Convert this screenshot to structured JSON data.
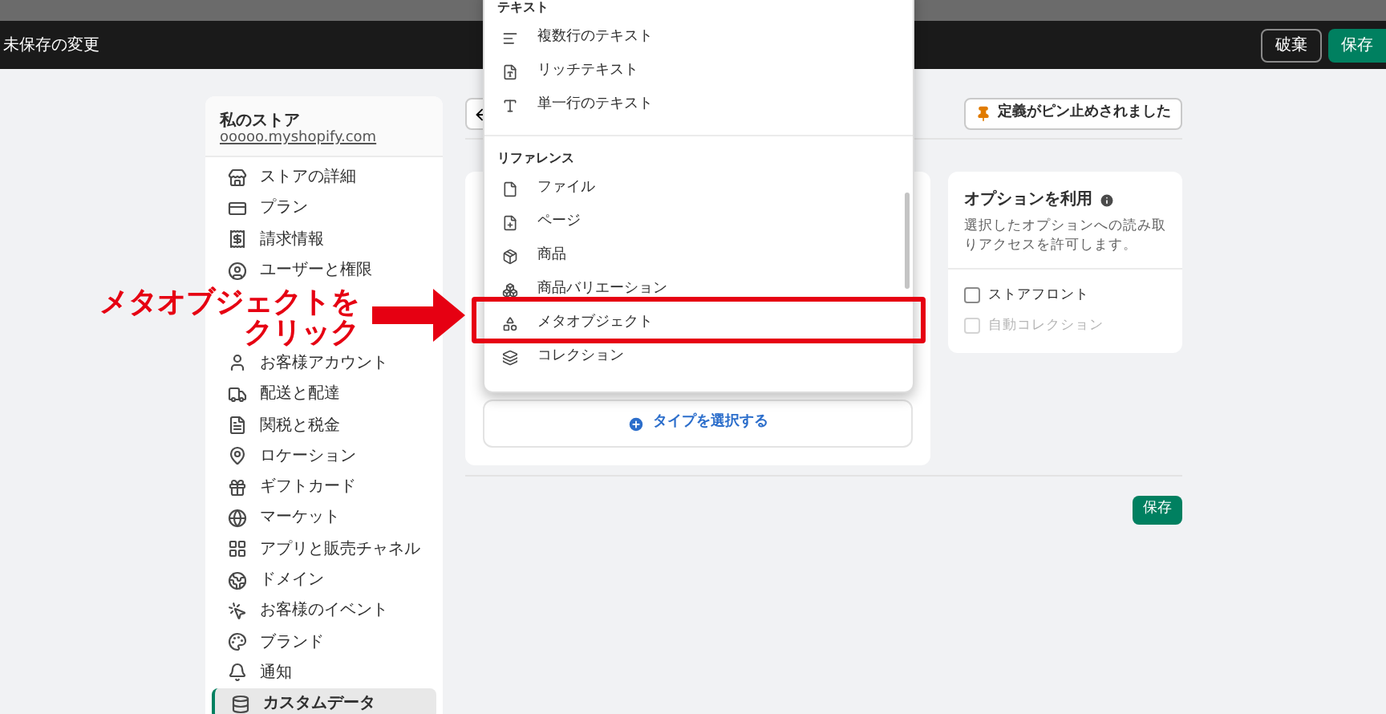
{
  "top_bar": {
    "title": "未保存の変更",
    "buttons": [
      {
        "label": "破棄",
        "kind": "secondary"
      },
      {
        "label": "保存",
        "kind": "primary"
      }
    ]
  },
  "sidebar": {
    "store_name": "私のストア",
    "store_url": "ooooo.myshopify.com",
    "items_top": [
      {
        "label": "ストアの詳細",
        "selected": false
      },
      {
        "label": "プラン",
        "selected": false
      },
      {
        "label": "請求情報",
        "selected": false
      },
      {
        "label": "ユーザーと権限",
        "selected": false
      }
    ],
    "items_bottom": [
      {
        "label": "お客様アカウント",
        "selected": false
      },
      {
        "label": "配送と配達",
        "selected": false
      },
      {
        "label": "関税と税金",
        "selected": false
      },
      {
        "label": "ロケーション",
        "selected": false
      },
      {
        "label": "ギフトカード",
        "selected": false
      },
      {
        "label": "マーケット",
        "selected": false
      },
      {
        "label": "アプリと販売チャネル",
        "selected": false
      },
      {
        "label": "ドメイン",
        "selected": false
      },
      {
        "label": "お客様のイベント",
        "selected": false
      },
      {
        "label": "ブランド",
        "selected": false
      },
      {
        "label": "通知",
        "selected": false
      },
      {
        "label": "カスタムデータ",
        "selected": true
      }
    ]
  },
  "pin_button": {
    "label": "定義がピン止めされました"
  },
  "select_type_button": {
    "label": "タイプを選択する"
  },
  "options_card": {
    "title": "オプションを利用",
    "description": "選択したオプションへの読み取りアクセスを許可します。",
    "options": [
      {
        "label": "ストアフロント",
        "checked": false,
        "disabled": false
      },
      {
        "label": "自動コレクション",
        "checked": false,
        "disabled": true
      }
    ]
  },
  "save_button": {
    "label": "保存"
  },
  "dropdown": {
    "sections": [
      {
        "heading": "テキスト",
        "items": [
          {
            "label": "複数行のテキスト",
            "callout": false
          },
          {
            "label": "リッチテキスト",
            "callout": false
          },
          {
            "label": "単一行のテキスト",
            "callout": false
          }
        ]
      },
      {
        "heading": "リファレンス",
        "items": [
          {
            "label": "ファイル",
            "callout": false
          },
          {
            "label": "ページ",
            "callout": false
          },
          {
            "label": "商品",
            "callout": false
          },
          {
            "label": "商品バリエーション",
            "callout": false
          },
          {
            "label": "メタオブジェクト",
            "callout": true
          },
          {
            "label": "コレクション",
            "callout": false
          }
        ]
      }
    ]
  },
  "annotation": {
    "lines": [
      "メタオブジェクトを",
      "クリック"
    ]
  }
}
